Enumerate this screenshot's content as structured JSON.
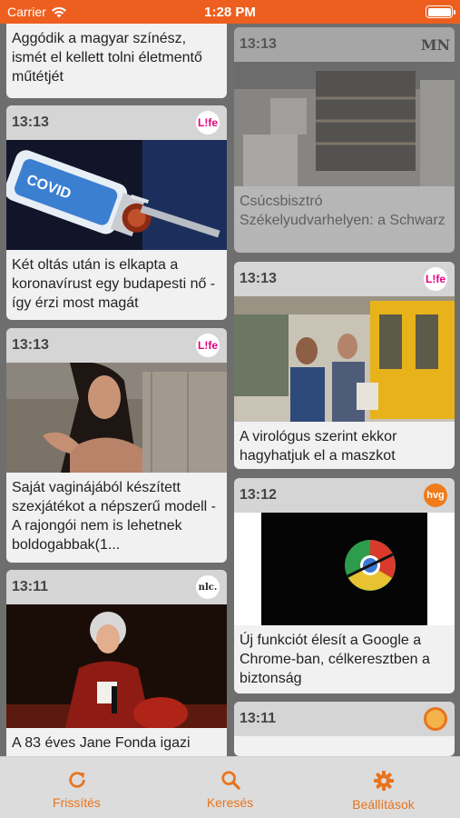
{
  "status": {
    "carrier": "Carrier",
    "time": "1:28 PM"
  },
  "colors": {
    "accent": "#e8741d",
    "status_bar": "#ee5f1f"
  },
  "feed": {
    "left": [
      {
        "title": "Aggódik a magyar színész, ismét el kellett tolni életmentő műtétjét"
      },
      {
        "time": "13:13",
        "source_logo": "L!fe",
        "image": "covid-vaccine-syringe",
        "title": "Két oltás után is elkapta a koronavírust egy budapesti nő - így érzi most magát"
      },
      {
        "time": "13:13",
        "source_logo": "L!fe",
        "image": "woman-portrait",
        "title": "Saját vaginájából készített szexjátékot a népszerű modell - A rajongói nem is lehetnek boldogabbak(1..."
      },
      {
        "time": "13:11",
        "source_logo": "nlc.",
        "image": "jane-fonda-red-carpet",
        "title": "A 83 éves Jane Fonda igazi"
      }
    ],
    "right": [
      {
        "time": "13:13",
        "source_logo": "MN",
        "image": "bistro-interior",
        "title": "Csúcsbisztró Székelyudvarhelyen: a Schwarz"
      },
      {
        "time": "13:13",
        "source_logo": "L!fe",
        "image": "tram-people-masks",
        "title": "A virológus szerint ekkor hagyhatjuk el a maszkot"
      },
      {
        "time": "13:12",
        "source_logo": "hvg",
        "image": "chrome-logo",
        "title": "Új funkciót élesít a Google a Chrome-ban, célkeresztben a biztonság"
      },
      {
        "time": "13:11",
        "source_logo": ""
      }
    ]
  },
  "tabs": [
    {
      "label": "Frissítés",
      "icon": "refresh-icon"
    },
    {
      "label": "Keresés",
      "icon": "search-icon"
    },
    {
      "label": "Beállítások",
      "icon": "gear-icon"
    }
  ]
}
